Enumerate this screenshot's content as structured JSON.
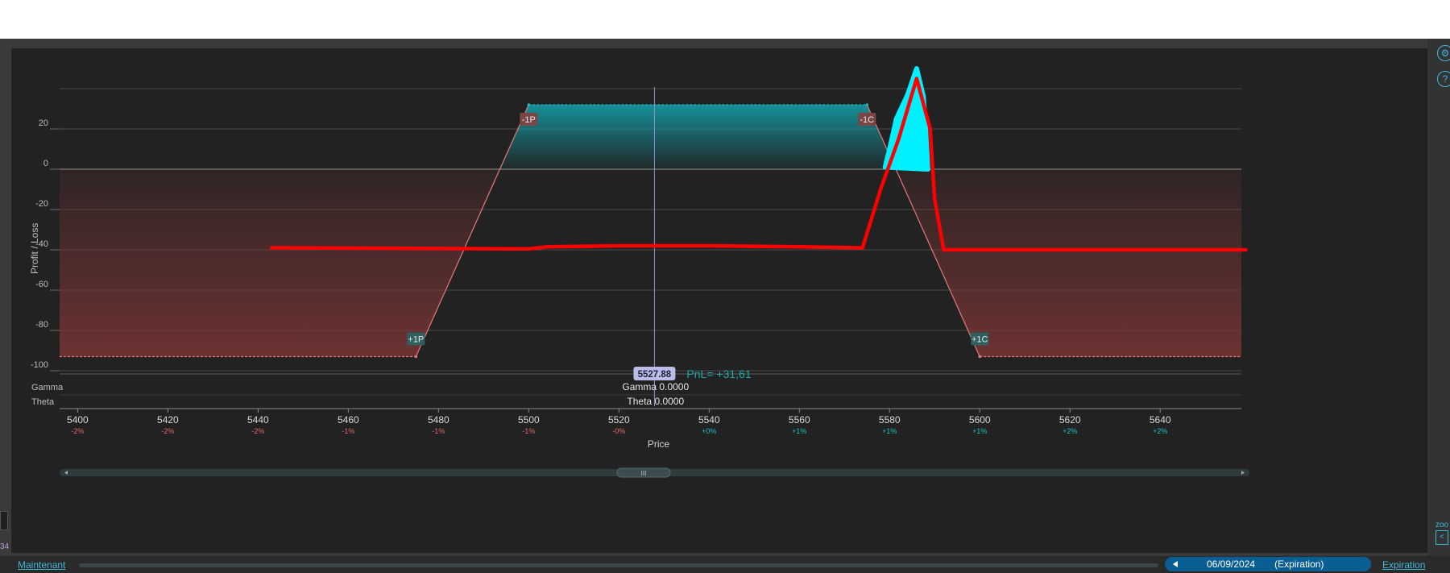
{
  "chart_data": {
    "type": "line",
    "ylabel": "Profit / Loss",
    "xlabel": "Price",
    "xlim": [
      5396,
      5658
    ],
    "ylim": [
      -100,
      40
    ],
    "y_ticks": [
      20,
      0,
      -20,
      -40,
      -60,
      -80,
      -100
    ],
    "x_ticks": [
      {
        "value": 5400,
        "label": "5400",
        "pct": "-2%"
      },
      {
        "value": 5420,
        "label": "5420",
        "pct": "-2%"
      },
      {
        "value": 5440,
        "label": "5440",
        "pct": "-2%"
      },
      {
        "value": 5460,
        "label": "5460",
        "pct": "-1%"
      },
      {
        "value": 5480,
        "label": "5480",
        "pct": "-1%"
      },
      {
        "value": 5500,
        "label": "5500",
        "pct": "-1%"
      },
      {
        "value": 5520,
        "label": "5520",
        "pct": "-0%"
      },
      {
        "value": 5540,
        "label": "5540",
        "pct": "+0%"
      },
      {
        "value": 5560,
        "label": "5560",
        "pct": "+1%"
      },
      {
        "value": 5580,
        "label": "5580",
        "pct": "+1%"
      },
      {
        "value": 5600,
        "label": "5600",
        "pct": "+1%"
      },
      {
        "value": 5620,
        "label": "5620",
        "pct": "+2%"
      },
      {
        "value": 5640,
        "label": "5640",
        "pct": "+2%"
      }
    ],
    "series": [
      {
        "x": [
          5396,
          5475,
          5500,
          5575,
          5600,
          5658
        ],
        "y": [
          -93,
          -93,
          32,
          32,
          -93,
          -93
        ]
      }
    ],
    "legs": [
      {
        "label": "+1P",
        "x": 5475,
        "y": -93
      },
      {
        "label": "-1P",
        "x": 5500,
        "y": 32
      },
      {
        "label": "-1C",
        "x": 5575,
        "y": 32
      },
      {
        "label": "+1C",
        "x": 5600,
        "y": -93
      }
    ],
    "current_price": {
      "value": 5527.88,
      "label": "5527.88"
    },
    "pnl_text": "PnL= +31,61",
    "gamma_row_label": "Gamma",
    "theta_row_label": "Theta",
    "gamma_readout": "Gamma 0.0000",
    "theta_readout": "Theta 0.0000",
    "colors": {
      "profit_fill": "#139ca6",
      "loss_fill": "#7a3535",
      "payoff_line": "#e07a7a",
      "profit_edge": "#20b6bf",
      "price_line": "#8f8fd4",
      "annotation_red": "#ff0000",
      "annotation_cyan": "#00f0ff"
    },
    "annotations": {
      "red_path": [
        [
          5443,
          -39
        ],
        [
          5500,
          -39.5
        ],
        [
          5504,
          -38.5
        ],
        [
          5520,
          -38
        ],
        [
          5540,
          -38
        ],
        [
          5560,
          -38.5
        ],
        [
          5574,
          -39
        ],
        [
          5578,
          -10
        ],
        [
          5582,
          15
        ],
        [
          5586,
          45
        ],
        [
          5589,
          20
        ],
        [
          5590,
          -15
        ],
        [
          5592,
          -40
        ],
        [
          5600,
          -40
        ],
        [
          5620,
          -40
        ],
        [
          5640,
          -40
        ],
        [
          5659,
          -40
        ]
      ],
      "cyan_shape": [
        [
          5579,
          1
        ],
        [
          5580,
          10
        ],
        [
          5581.5,
          25
        ],
        [
          5584,
          37
        ],
        [
          5586,
          50
        ],
        [
          5587.5,
          36
        ],
        [
          5588,
          20
        ],
        [
          5588.5,
          0
        ]
      ]
    }
  },
  "scrollbar": {
    "thumb_label": "III"
  },
  "bottom": {
    "maint_label": "Maintenant",
    "date_label": "06/09/2024",
    "expiration_tag": "(Expiration)",
    "expiration_link": "Expiration"
  },
  "right_panel": {
    "help_label": "?",
    "zoom_label": "zoo"
  },
  "left_panel": {
    "number_label": "34"
  }
}
